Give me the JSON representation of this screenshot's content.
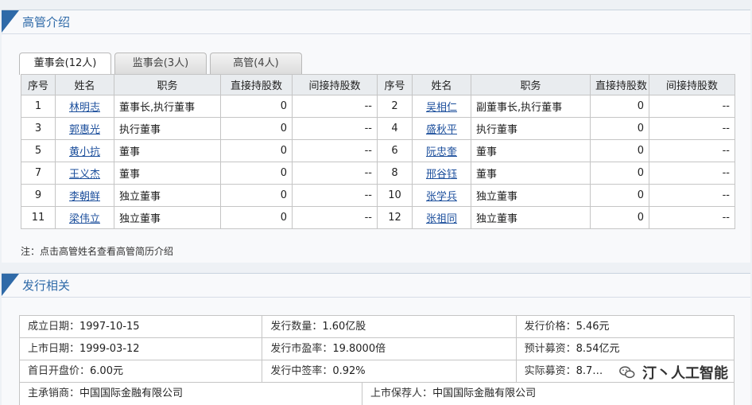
{
  "management": {
    "title": "高管介绍",
    "tabs": [
      "董事会(12人)",
      "监事会(3人)",
      "高管(4人)"
    ],
    "headers": [
      "序号",
      "姓名",
      "职务",
      "直接持股数",
      "间接持股数",
      "序号",
      "姓名",
      "职务",
      "直接持股数",
      "间接持股数"
    ],
    "rows": [
      {
        "l": {
          "no": "1",
          "name": "林明志",
          "title": "董事长,执行董事",
          "direct": "0",
          "indirect": "--"
        },
        "r": {
          "no": "2",
          "name": "吴相仁",
          "title": "副董事长,执行董事",
          "direct": "0",
          "indirect": "--"
        }
      },
      {
        "l": {
          "no": "3",
          "name": "郭惠光",
          "title": "执行董事",
          "direct": "0",
          "indirect": "--"
        },
        "r": {
          "no": "4",
          "name": "盛秋平",
          "title": "执行董事",
          "direct": "0",
          "indirect": "--"
        }
      },
      {
        "l": {
          "no": "5",
          "name": "黄小抗",
          "title": "董事",
          "direct": "0",
          "indirect": "--"
        },
        "r": {
          "no": "6",
          "name": "阮忠奎",
          "title": "董事",
          "direct": "0",
          "indirect": "--"
        }
      },
      {
        "l": {
          "no": "7",
          "name": "王义杰",
          "title": "董事",
          "direct": "0",
          "indirect": "--"
        },
        "r": {
          "no": "8",
          "name": "邢谷钰",
          "title": "董事",
          "direct": "0",
          "indirect": "--"
        }
      },
      {
        "l": {
          "no": "9",
          "name": "李朝鲜",
          "title": "独立董事",
          "direct": "0",
          "indirect": "--"
        },
        "r": {
          "no": "10",
          "name": "张学兵",
          "title": "独立董事",
          "direct": "0",
          "indirect": "--"
        }
      },
      {
        "l": {
          "no": "11",
          "name": "梁伟立",
          "title": "独立董事",
          "direct": "0",
          "indirect": "--"
        },
        "r": {
          "no": "12",
          "name": "张祖同",
          "title": "独立董事",
          "direct": "0",
          "indirect": "--"
        }
      }
    ],
    "note": "注：点击高管姓名查看高管简历介绍"
  },
  "issuance": {
    "title": "发行相关",
    "rows": [
      [
        {
          "label": "成立日期：",
          "value": "1997-10-15"
        },
        {
          "label": "发行数量：",
          "value": "1.60亿股"
        },
        {
          "label": "发行价格：",
          "value": "5.46元"
        }
      ],
      [
        {
          "label": "上市日期：",
          "value": "1999-03-12"
        },
        {
          "label": "发行市盈率：",
          "value": "19.8000倍"
        },
        {
          "label": "预计募资：",
          "value": "8.54亿元"
        }
      ],
      [
        {
          "label": "首日开盘价：",
          "value": "6.00元"
        },
        {
          "label": "发行中签率：",
          "value": "0.92%"
        },
        {
          "label": "实际募资：",
          "value": "8.7…"
        }
      ]
    ],
    "bottom": [
      {
        "label": "主承销商：",
        "value": "中国国际金融有限公司"
      },
      {
        "label": "上市保荐人：",
        "value": "中国国际金融有限公司"
      }
    ]
  },
  "watermark_text": "汀丶人工智能",
  "watermark_icon": "wechat-icon"
}
